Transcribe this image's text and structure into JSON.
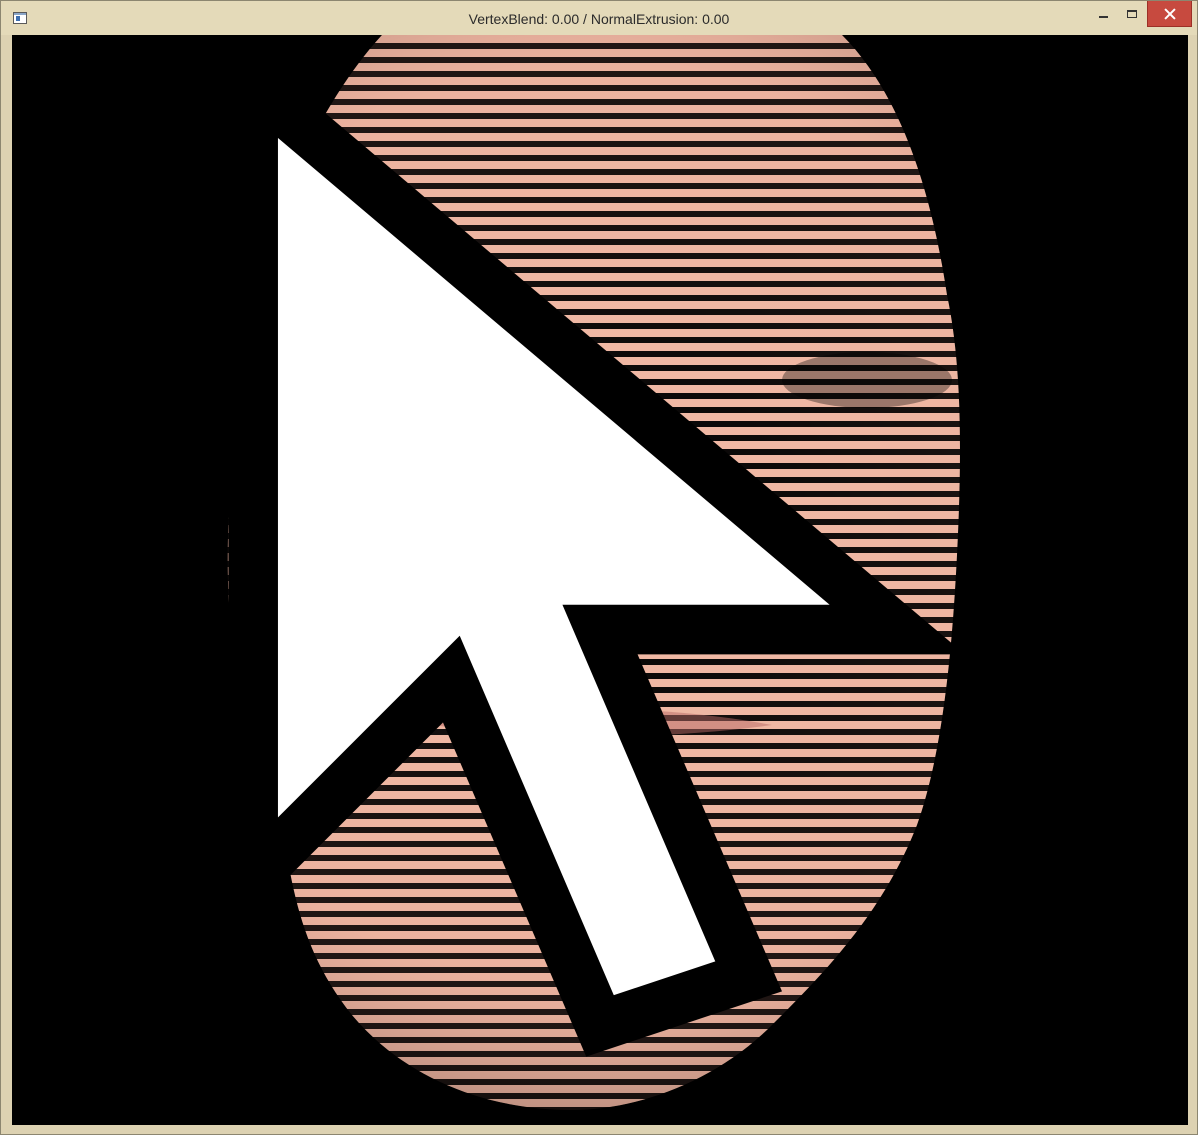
{
  "window": {
    "title": "VertexBlend: 0.00 / NormalExtrusion: 0.00",
    "controls": {
      "minimize_icon": "minimize-icon",
      "maximize_icon": "maximize-icon",
      "close_icon": "close-icon"
    }
  },
  "viewport": {
    "background_color": "#000000",
    "content": "3d-face-mesh-render",
    "stripe_color_light": "#f0b8a4",
    "stripe_color_dark": "#c98a77"
  },
  "colors": {
    "titlebar": "#e4dab9",
    "frame": "#ddd2b2",
    "close_button": "#c74a3f"
  }
}
